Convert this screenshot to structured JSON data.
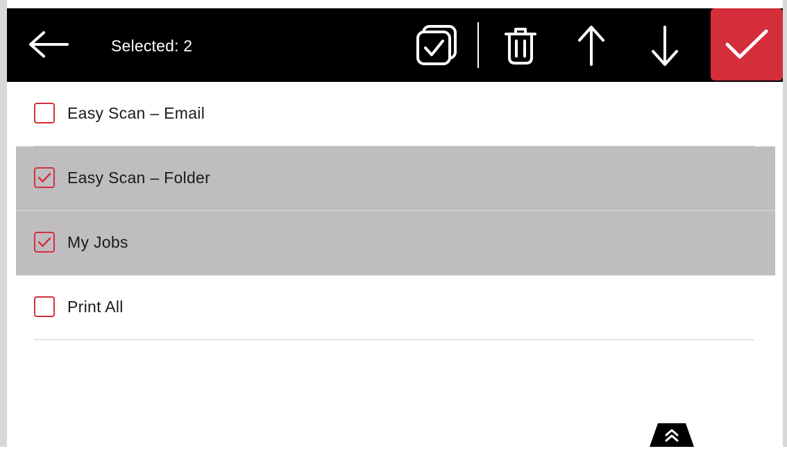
{
  "header": {
    "selected_text": "Selected: 2",
    "icons": {
      "back": "arrow-left-icon",
      "select_all": "select-all-icon",
      "delete": "trash-icon",
      "move_up": "arrow-up-icon",
      "move_down": "arrow-down-icon",
      "confirm": "checkmark-icon",
      "expand": "double-chevron-up-icon"
    }
  },
  "list": {
    "items": [
      {
        "label": "Easy Scan – Email",
        "checked": false
      },
      {
        "label": "Easy Scan – Folder",
        "checked": true
      },
      {
        "label": "My Jobs",
        "checked": true
      },
      {
        "label": "Print All",
        "checked": false
      }
    ]
  },
  "colors": {
    "header_bg": "#000000",
    "accent_red": "#d42e3b",
    "selected_row_bg": "#bfbdc0",
    "text": "#1a1a1a",
    "header_text": "#ffffff"
  }
}
